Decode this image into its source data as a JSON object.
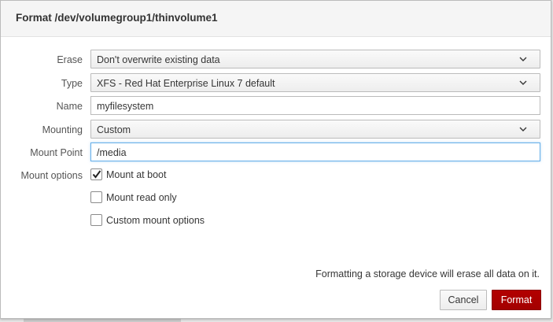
{
  "dialog": {
    "title": "Format /dev/volumegroup1/thinvolume1"
  },
  "form": {
    "erase": {
      "label": "Erase",
      "value": "Don't overwrite existing data"
    },
    "type": {
      "label": "Type",
      "value": "XFS - Red Hat Enterprise Linux 7 default"
    },
    "name": {
      "label": "Name",
      "value": "myfilesystem"
    },
    "mounting": {
      "label": "Mounting",
      "value": "Custom"
    },
    "mount_point": {
      "label": "Mount Point",
      "value": "/media"
    },
    "mount_options": {
      "label": "Mount options",
      "mount_at_boot": {
        "label": "Mount at boot",
        "checked": true
      },
      "mount_read_only": {
        "label": "Mount read only",
        "checked": false
      },
      "custom_mount_options": {
        "label": "Custom mount options",
        "checked": false
      }
    }
  },
  "footer": {
    "warning": "Formatting a storage device will erase all data on it.",
    "cancel_label": "Cancel",
    "format_label": "Format"
  },
  "colors": {
    "primary_button": "#a30000",
    "focus_border": "#66afe9"
  },
  "icons": {
    "select_caret": "chevron-down-icon",
    "checkbox_mark": "checkmark-icon"
  }
}
